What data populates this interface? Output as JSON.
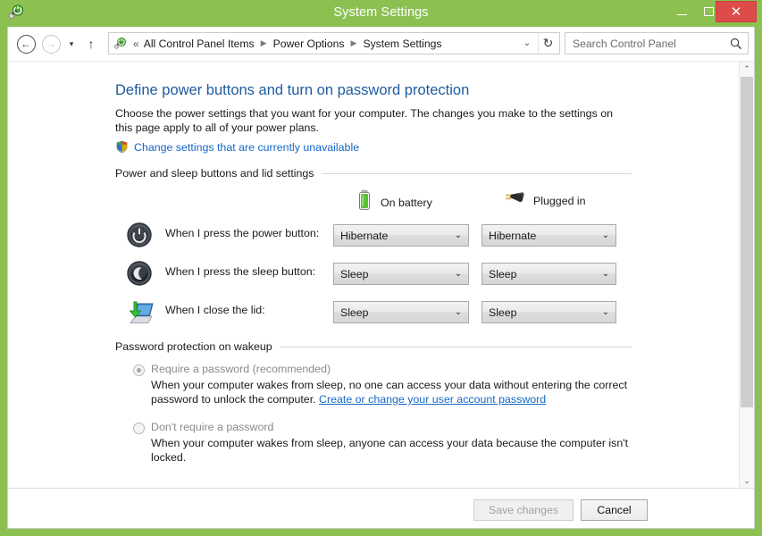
{
  "window": {
    "title": "System Settings",
    "icon": "power-options-icon",
    "controls": {
      "minimize": "minimize-icon",
      "maximize": "maximize-icon",
      "close": "✕",
      "close_color": "#DD4B4B"
    },
    "titlebar_color": "#8CC152"
  },
  "navbar": {
    "back_glyph": "←",
    "forward_glyph": "→",
    "recent_glyph": "▾",
    "up_glyph": "↑",
    "breadcrumb": {
      "icon": "power-options-icon",
      "overflow": "«",
      "items": [
        {
          "label": "All Control Panel Items"
        },
        {
          "label": "Power Options"
        },
        {
          "label": "System Settings"
        }
      ],
      "separator": "▶",
      "dropdown_glyph": "⌄",
      "refresh_glyph": "↻"
    },
    "search": {
      "placeholder": "Search Control Panel",
      "value": "",
      "icon": "search-icon"
    }
  },
  "page": {
    "heading": "Define power buttons and turn on password protection",
    "heading_color": "#1E5B9E",
    "description": "Choose the power settings that you want for your computer. The changes you make to the settings on this page apply to all of your power plans.",
    "admin_link": {
      "label": "Change settings that are currently unavailable",
      "icon": "uac-shield-icon",
      "color": "#1768C6"
    },
    "power_group": {
      "title": "Power and sleep buttons and lid settings",
      "columns": [
        {
          "label": "On battery",
          "icon": "battery-icon"
        },
        {
          "label": "Plugged in",
          "icon": "power-plug-icon"
        }
      ],
      "rows": [
        {
          "icon": "power-button-icon",
          "label": "When I press the power button:",
          "on_battery": "Hibernate",
          "plugged_in": "Hibernate"
        },
        {
          "icon": "sleep-button-icon",
          "label": "When I press the sleep button:",
          "on_battery": "Sleep",
          "plugged_in": "Sleep"
        },
        {
          "icon": "laptop-lid-icon",
          "label": "When I close the lid:",
          "on_battery": "Sleep",
          "plugged_in": "Sleep"
        }
      ],
      "dropdown_arrow": "⌄"
    },
    "password_group": {
      "title": "Password protection on wakeup",
      "options": [
        {
          "label": "Require a password (recommended)",
          "selected": true,
          "disabled": true,
          "description_before": "When your computer wakes from sleep, no one can access your data without entering the correct password to unlock the computer. ",
          "link_label": "Create or change your user account password",
          "description_after": ""
        },
        {
          "label": "Don't require a password",
          "selected": false,
          "disabled": true,
          "description_before": "When your computer wakes from sleep, anyone can access your data because the computer isn't locked.",
          "link_label": "",
          "description_after": ""
        }
      ]
    }
  },
  "scrollbar": {
    "up_glyph": "⌃",
    "down_glyph": "⌄"
  },
  "footer": {
    "save_label": "Save changes",
    "save_enabled": false,
    "cancel_label": "Cancel"
  }
}
